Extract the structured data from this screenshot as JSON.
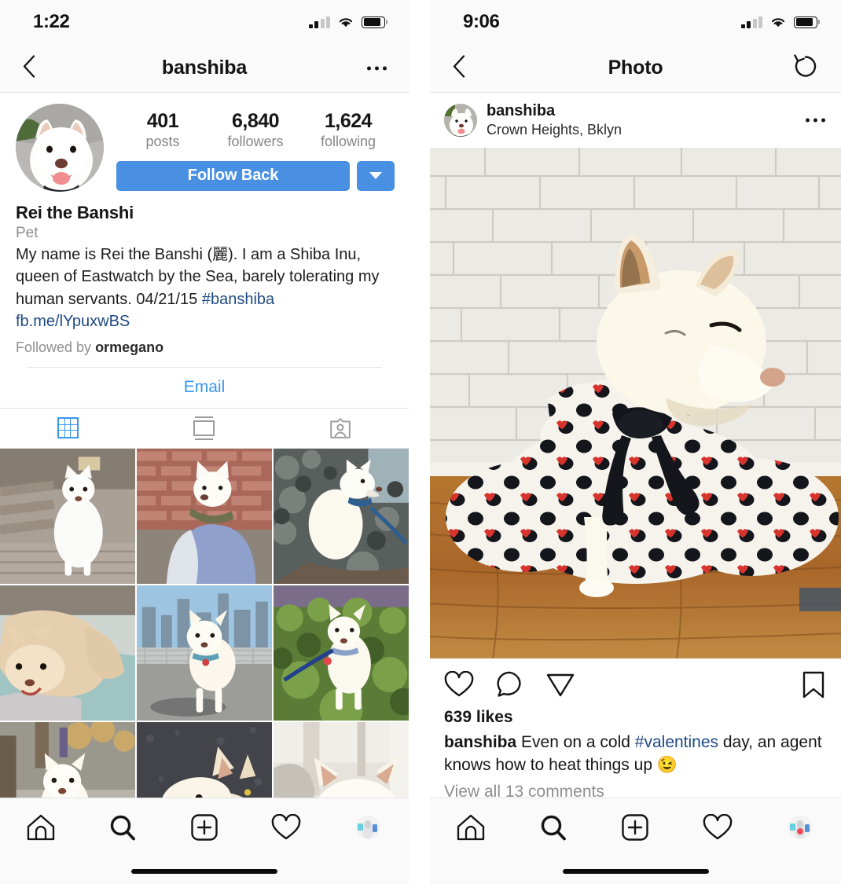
{
  "left_phone": {
    "status": {
      "time": "1:22",
      "signal_icon": "signal-bars-icon",
      "wifi_icon": "wifi-icon",
      "battery_icon": "battery-icon"
    },
    "navbar": {
      "back_icon": "back-chevron-icon",
      "title": "banshiba",
      "more_icon": "more-options-icon"
    },
    "profile": {
      "avatar_name": "profile-avatar",
      "stats": [
        {
          "value": "401",
          "label": "posts"
        },
        {
          "value": "6,840",
          "label": "followers"
        },
        {
          "value": "1,624",
          "label": "following"
        }
      ],
      "follow_button": "Follow Back",
      "caret_icon": "chevron-down-icon",
      "display_name": "Rei the Banshi",
      "category": "Pet",
      "bio_line1": "My name is Rei the Banshi (麗). I am a Shiba Inu,",
      "bio_line2": "queen of Eastwatch by the Sea, barely tolerating my",
      "bio_line3": "human servants. 04/21/15 ",
      "bio_hashtag": "#banshiba",
      "website": "fb.me/lYpuxwBS",
      "followed_by_prefix": "Followed by ",
      "followed_by_user": "ormegano",
      "email_button": "Email"
    },
    "tabs": [
      {
        "name": "grid-tab",
        "icon": "grid-icon",
        "active": true
      },
      {
        "name": "list-tab",
        "icon": "list-view-icon",
        "active": false
      },
      {
        "name": "tagged-tab",
        "icon": "tagged-person-icon",
        "active": false
      }
    ],
    "grid_posts": [
      {
        "alt": "white shiba sitting on wooden bench"
      },
      {
        "alt": "shiba in blue blanket by brick wall"
      },
      {
        "alt": "shiba on rocks with blue leash"
      },
      {
        "alt": "shiba lying on teal blanket"
      },
      {
        "alt": "shiba standing with city skyline"
      },
      {
        "alt": "shiba standing in green grass"
      },
      {
        "alt": "shiba on street with blue collar"
      },
      {
        "alt": "shiba profile on asphalt"
      },
      {
        "alt": "shiba closeup indoors"
      }
    ],
    "bottom_nav": [
      {
        "name": "home-tab",
        "icon": "home-icon"
      },
      {
        "name": "search-tab",
        "icon": "search-icon"
      },
      {
        "name": "new-post-tab",
        "icon": "plus-square-icon"
      },
      {
        "name": "activity-tab",
        "icon": "heart-icon"
      },
      {
        "name": "profile-tab",
        "icon": "profile-avatar-icon"
      }
    ],
    "has_notification_dot": false
  },
  "right_phone": {
    "status": {
      "time": "9:06",
      "signal_icon": "signal-bars-icon",
      "wifi_icon": "wifi-icon",
      "battery_icon": "battery-icon"
    },
    "navbar": {
      "back_icon": "back-chevron-icon",
      "title": "Photo",
      "refresh_icon": "refresh-icon"
    },
    "post": {
      "username": "banshiba",
      "location": "Crown Heights, Bklyn",
      "more_icon": "more-options-icon",
      "photo_alt": "cream shiba inu wrapped in black and white polka dot blanket on wood floor against white brick wall",
      "like_icon": "heart-icon",
      "comment_icon": "comment-bubble-icon",
      "share_icon": "send-paper-plane-icon",
      "save_icon": "bookmark-icon",
      "likes": "639 likes",
      "caption_user": "banshiba",
      "caption_pre": " Even on a cold ",
      "caption_hashtag": "#valentines",
      "caption_post": " day, an agent knows how to heat things up 😉",
      "view_comments": "View all 13 comments"
    },
    "bottom_nav": [
      {
        "name": "home-tab",
        "icon": "home-icon"
      },
      {
        "name": "search-tab",
        "icon": "search-icon"
      },
      {
        "name": "new-post-tab",
        "icon": "plus-square-icon"
      },
      {
        "name": "activity-tab",
        "icon": "heart-icon"
      },
      {
        "name": "profile-tab",
        "icon": "profile-avatar-icon"
      }
    ],
    "has_notification_dot": true
  },
  "colors": {
    "accent_blue": "#3897f0",
    "button_blue": "#4a90e2",
    "link_navy": "#1e4a82",
    "muted_gray": "#8e8e8e",
    "notification_red": "#ed4956",
    "bar_bg": "#fafafa"
  }
}
